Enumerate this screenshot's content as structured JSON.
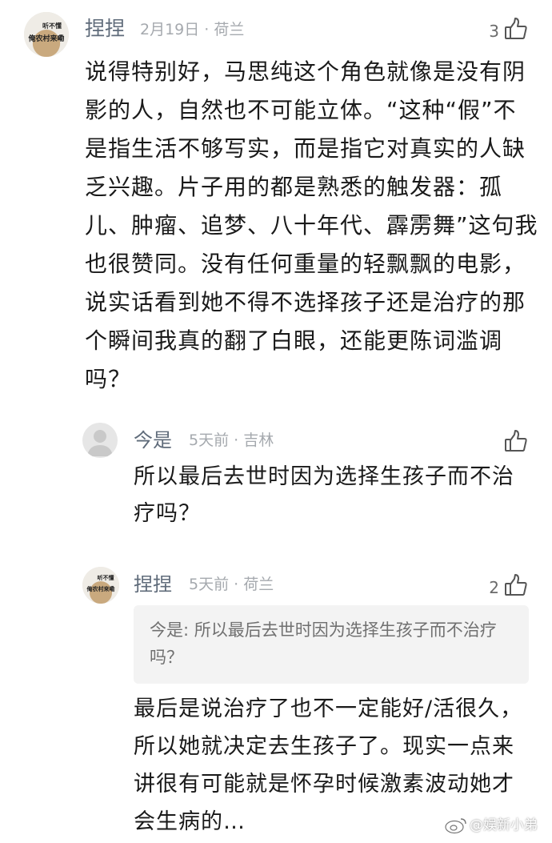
{
  "comments": [
    {
      "author": "捏捏",
      "meta": "2月19日 · 荷兰",
      "likes": "3",
      "avatar_text": [
        "听不懂",
        "俺农村来嘞"
      ],
      "body": "说得特别好，马思纯这个角色就像是没有阴影的人，自然也不可能立体。“这种“假”不是指生活不够写实，而是指它对真实的人缺乏兴趣。片子用的都是熟悉的触发器：孤儿、肿瘤、追梦、八十年代、霹雳舞”这句我也很赞同。没有任何重量的轻飘飘的电影，说实话看到她不得不选择孩子还是治疗的那个瞬间我真的翻了白眼，还能更陈词滥调吗？"
    },
    {
      "author": "今是",
      "meta": "5天前 · 吉林",
      "likes": "",
      "body": "所以最后去世时因为选择生孩子而不治疗吗？"
    },
    {
      "author": "捏捏",
      "meta": "5天前 · 荷兰",
      "likes": "2",
      "avatar_text": [
        "听不懂",
        "俺农村来嘞"
      ],
      "quote": "今是: 所以最后去世时因为选择生孩子而不治疗吗？",
      "body": "最后是说治疗了也不一定能好/活很久，所以她就决定去生孩子了。现实一点来讲很有可能就是怀孕时候激素波动她才会生病的…"
    }
  ],
  "watermark": "@娱新小弟",
  "icons": {
    "like": "thumbs-up-icon",
    "weibo": "weibo-logo-icon"
  },
  "colors": {
    "author": "#5f6b7a",
    "meta": "#a5a9ae",
    "text": "#1a1a1a",
    "quote_bg": "#f3f3f3"
  }
}
